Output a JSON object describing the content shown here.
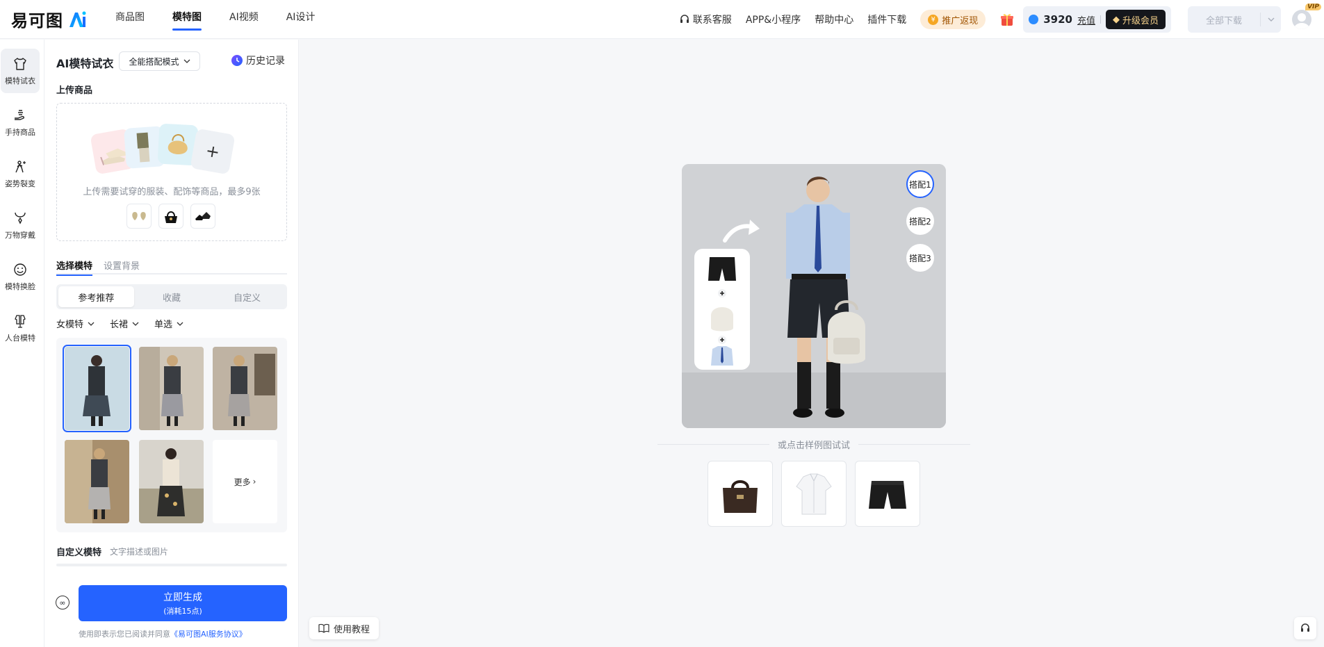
{
  "brand": {
    "logo_text": "易可图",
    "accent": "#2563ff"
  },
  "nav": {
    "items": [
      {
        "label": "商品图",
        "active": false
      },
      {
        "label": "模特图",
        "active": true
      },
      {
        "label": "AI视频",
        "active": false
      },
      {
        "label": "AI设计",
        "active": false
      }
    ]
  },
  "header": {
    "support": "联系客服",
    "app": "APP&小程序",
    "help": "帮助中心",
    "plugin": "插件下载",
    "promo": "推广返现",
    "credits": "3920",
    "recharge": "充值",
    "vip": "升级会员",
    "download": "全部下载",
    "vip_tag": "VIP"
  },
  "rail": {
    "items": [
      {
        "label": "模特试衣",
        "icon": "shirt-icon",
        "active": true
      },
      {
        "label": "手持商品",
        "icon": "hand-icon",
        "active": false
      },
      {
        "label": "姿势裂变",
        "icon": "pose-icon",
        "active": false
      },
      {
        "label": "万物穿戴",
        "icon": "necklace-icon",
        "active": false
      },
      {
        "label": "模特换脸",
        "icon": "face-icon",
        "active": false
      },
      {
        "label": "人台模特",
        "icon": "mannequin-icon",
        "active": false
      }
    ]
  },
  "panel": {
    "title": "AI模特试衣",
    "mode": "全能搭配模式",
    "history": "历史记录",
    "upload_title": "上传商品",
    "upload_hint": "上传需要试穿的服装、配饰等商品，最多9张",
    "tabs": [
      "选择模特",
      "设置背景"
    ],
    "segments": [
      "参考推荐",
      "收藏",
      "自定义"
    ],
    "filters": [
      "女模特",
      "长裙",
      "单选"
    ],
    "more": "更多",
    "custom_label": "自定义模特",
    "custom_hint": "文字描述或图片",
    "generate": "立即生成",
    "generate_cost": "(消耗15点)",
    "agree_prefix": "使用即表示您已阅读并同意",
    "agree_link": "《易可图AI服务协议》"
  },
  "canvas": {
    "matches": [
      "搭配1",
      "搭配2",
      "搭配3"
    ],
    "or_try": "或点击样例图试试",
    "tutorial": "使用教程"
  }
}
